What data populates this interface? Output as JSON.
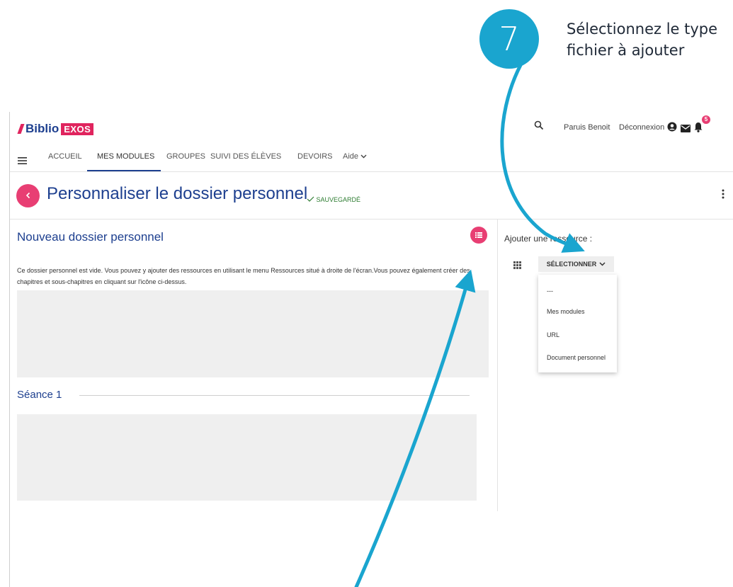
{
  "tutorial": {
    "step_number": "7",
    "instruction_line1": "Sélectionnez le type",
    "instruction_line2": "fichier à ajouter",
    "accent_color": "#1aa5cf"
  },
  "brand": {
    "logo_main": "Biblio",
    "logo_badge": "EXOS",
    "brand_color": "#1d3f8f",
    "accent_color": "#e83e73"
  },
  "header": {
    "search_icon": "search-icon",
    "user_name": "Paruis Benoit",
    "logout_label": "Déconnexion",
    "account_icon": "account-circle-icon",
    "mail_icon": "mail-icon",
    "bell_icon": "bell-icon",
    "notification_count": "5"
  },
  "nav": {
    "menu_icon": "hamburger-menu-icon",
    "items": [
      {
        "label": "ACCUEIL"
      },
      {
        "label": "MES MODULES",
        "active": true
      },
      {
        "label": "GROUPES"
      },
      {
        "label": "SUIVI DES ÉLÈVES"
      },
      {
        "label": "DEVOIRS"
      },
      {
        "label": "Aide"
      }
    ]
  },
  "page": {
    "back_icon": "chevron-left-icon",
    "title": "Personnaliser le dossier personnel",
    "saved_label": "SAUVEGARDÉ"
  },
  "main": {
    "folder_title": "Nouveau dossier personnel",
    "list_icon": "list-icon",
    "description": "Ce dossier personnel est vide. Vous pouvez y ajouter des ressources en utilisant le menu Ressources situé à droite de l'écran.Vous pouvez également créer des chapitres et sous-chapitres en cliquant sur l'icône ci-dessus.",
    "session_title": "Séance 1"
  },
  "sidebar": {
    "add_resource_label": "Ajouter une ressource :",
    "grid_icon": "apps-grid-icon",
    "select_label": "SÉLECTIONNER",
    "options": [
      "---",
      "Mes modules",
      "URL",
      "Document personnel"
    ]
  }
}
